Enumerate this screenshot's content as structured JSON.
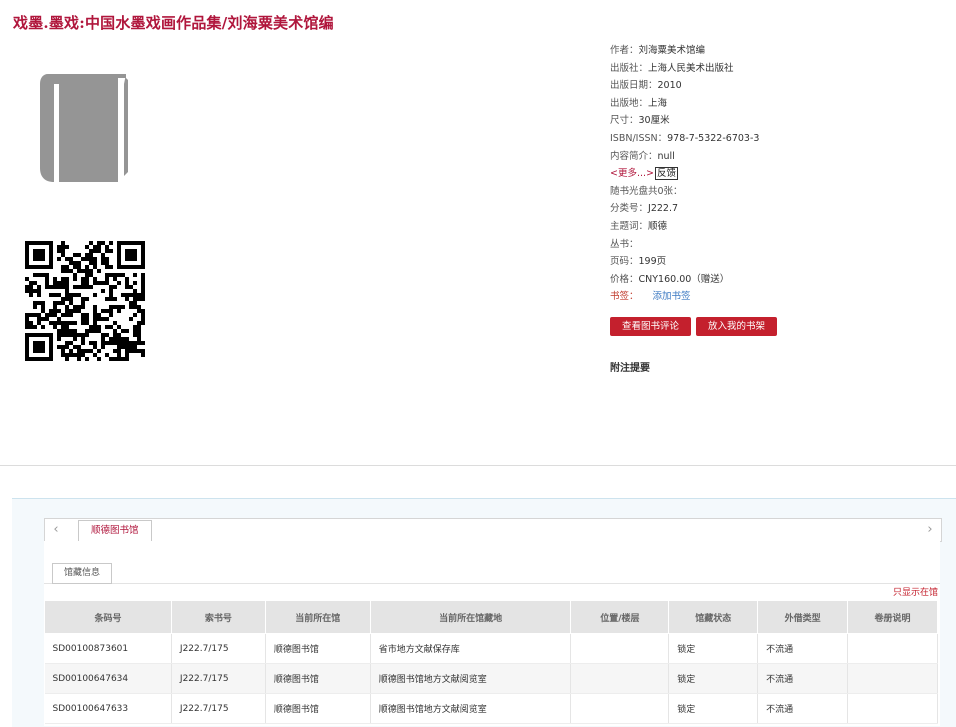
{
  "title": "戏墨.墨戏:中国水墨戏画作品集/刘海粟美术馆编",
  "details": [
    {
      "label": "作者：",
      "value": "刘海粟美术馆编"
    },
    {
      "label": "出版社：",
      "value": "上海人民美术出版社"
    },
    {
      "label": "出版日期：",
      "value": "2010"
    },
    {
      "label": "出版地：",
      "value": "上海"
    },
    {
      "label": "尺寸：",
      "value": "30厘米"
    },
    {
      "label": "ISBN/ISSN：",
      "value": "978-7-5322-6703-3"
    },
    {
      "label": "内容简介：",
      "value": "null"
    }
  ],
  "more_link": "<更多...>",
  "feedback": "反馈",
  "extra_details": [
    {
      "label": "随书光盘共0张：",
      "value": ""
    },
    {
      "label": "分类号：",
      "value": "J222.7"
    },
    {
      "label": "主题词：",
      "value": "顺德"
    },
    {
      "label": "丛书：",
      "value": ""
    },
    {
      "label": "页码：",
      "value": "199页"
    },
    {
      "label": "价格：",
      "value": "CNY160.00（赠送）"
    }
  ],
  "bookmark": {
    "label": "书签：",
    "add_link": "添加书签"
  },
  "buttons": {
    "view_reviews": "查看图书评论",
    "add_shelf": "放入我的书架"
  },
  "note_label": "附注提要",
  "holdings": {
    "prev_arrow": "‹",
    "next_arrow": "›",
    "library_tab": "顺德图书馆",
    "sub_tab": "馆藏信息",
    "only_show": "只显示在馆",
    "columns": [
      "条码号",
      "索书号",
      "当前所在馆",
      "当前所在馆藏地",
      "位置/楼层",
      "馆藏状态",
      "外借类型",
      "卷册说明"
    ],
    "rows": [
      [
        "SD00100873601",
        "J222.7/175",
        "顺德图书馆",
        "省市地方文献保存库",
        "",
        "锁定",
        "不流通",
        ""
      ],
      [
        "SD00100647634",
        "J222.7/175",
        "顺德图书馆",
        "顺德图书馆地方文献阅览室",
        "",
        "锁定",
        "不流通",
        ""
      ],
      [
        "SD00100647633",
        "J222.7/175",
        "顺德图书馆",
        "顺德图书馆地方文献阅览室",
        "",
        "锁定",
        "不流通",
        ""
      ]
    ]
  }
}
